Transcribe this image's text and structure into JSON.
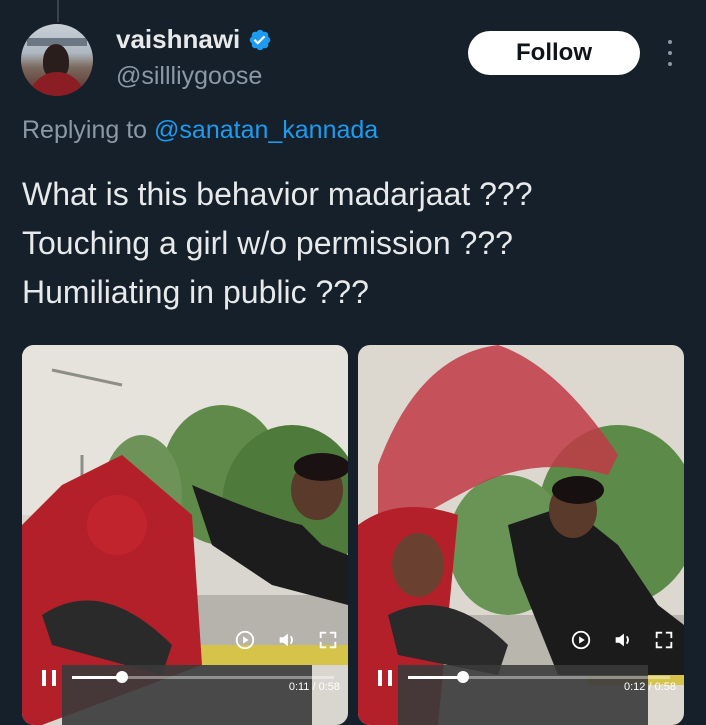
{
  "tweet": {
    "display_name": "vaishnawi",
    "handle": "@sillliygoose",
    "follow_label": "Follow",
    "reply_prefix": "Replying to ",
    "reply_mention": "@sanatan_kannada",
    "text_lines": [
      "What is this behavior madarjaat ???",
      "Touching a girl w/o permission ???",
      "Humiliating in public ???"
    ]
  },
  "videos": [
    {
      "time_label": "0:11 / 0:58",
      "progress": 0.19
    },
    {
      "time_label": "0:12 / 0:58",
      "progress": 0.21
    }
  ],
  "colors": {
    "background": "#15202b",
    "accent": "#1d9bf0",
    "secondary_text": "#8b98a5"
  },
  "icons": [
    "verified-badge-icon",
    "more-options-icon",
    "pause-icon",
    "replay-icon",
    "volume-icon",
    "fullscreen-icon"
  ]
}
